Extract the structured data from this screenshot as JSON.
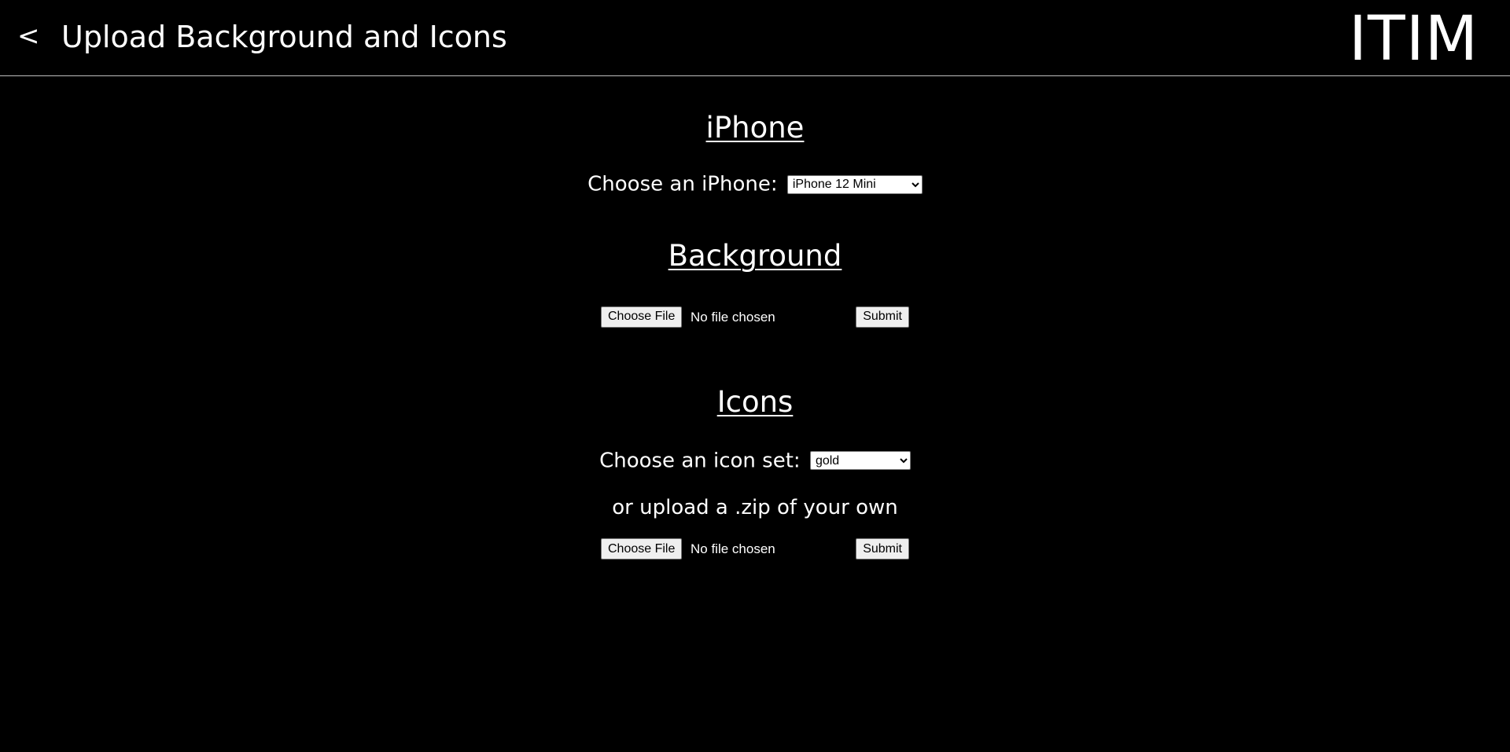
{
  "header": {
    "back_label": "<",
    "title": "Upload Background and Icons",
    "brand": "ITIM"
  },
  "iphone": {
    "heading": "iPhone",
    "choose_label": "Choose an iPhone:",
    "selected": "iPhone 12 Mini"
  },
  "background": {
    "heading": "Background",
    "choose_file_label": "Choose File",
    "file_status": "No file chosen",
    "submit_label": "Submit"
  },
  "icons": {
    "heading": "Icons",
    "choose_label": "Choose an icon set:",
    "selected": "gold",
    "upload_note": "or upload a .zip of your own",
    "choose_file_label": "Choose File",
    "file_status": "No file chosen",
    "submit_label": "Submit"
  }
}
